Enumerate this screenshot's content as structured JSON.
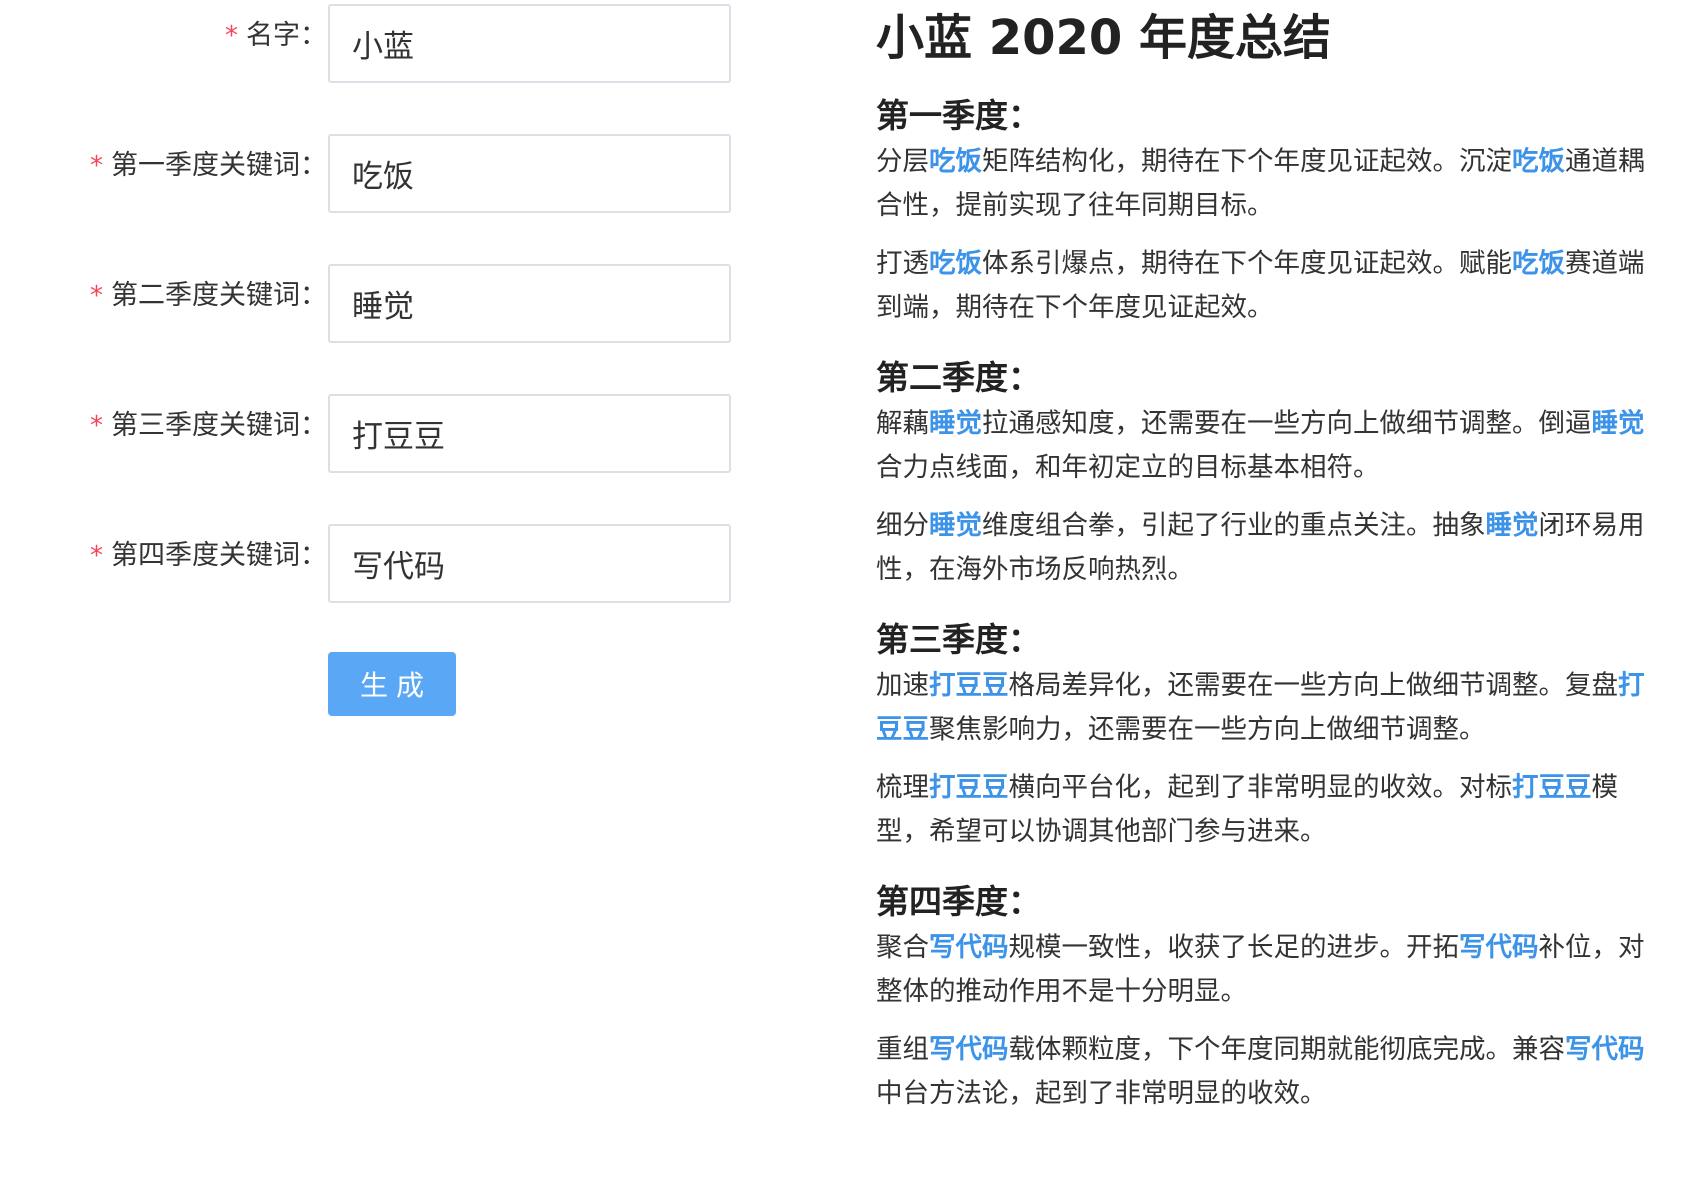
{
  "form": {
    "required_mark": "*",
    "fields": [
      {
        "label": "名字：",
        "value": "小蓝"
      },
      {
        "label": "第一季度关键词：",
        "value": "吃饭"
      },
      {
        "label": "第二季度关键词：",
        "value": "睡觉"
      },
      {
        "label": "第三季度关键词：",
        "value": "打豆豆"
      },
      {
        "label": "第四季度关键词：",
        "value": "写代码"
      }
    ],
    "submit_label": "生成"
  },
  "summary": {
    "title": "小蓝 2020 年度总结",
    "quarters": [
      {
        "heading": "第一季度：",
        "keyword": "吃饭",
        "paragraphs": [
          {
            "a": "分层",
            "b": "矩阵结构化，期待在下个年度见证起效。沉淀",
            "c": "通道耦合性，提前实现了往年同期目标。"
          },
          {
            "a": "打透",
            "b": "体系引爆点，期待在下个年度见证起效。赋能",
            "c": "赛道端到端，期待在下个年度见证起效。"
          }
        ]
      },
      {
        "heading": "第二季度：",
        "keyword": "睡觉",
        "paragraphs": [
          {
            "a": "解藕",
            "b": "拉通感知度，还需要在一些方向上做细节调整。倒逼",
            "c": "合力点线面，和年初定立的目标基本相符。"
          },
          {
            "a": "细分",
            "b": "维度组合拳，引起了行业的重点关注。抽象",
            "c": "闭环易用性，在海外市场反响热烈。"
          }
        ]
      },
      {
        "heading": "第三季度：",
        "keyword": "打豆豆",
        "paragraphs": [
          {
            "a": "加速",
            "b": "格局差异化，还需要在一些方向上做细节调整。复盘",
            "c": "聚焦影响力，还需要在一些方向上做细节调整。"
          },
          {
            "a": "梳理",
            "b": "横向平台化，起到了非常明显的收效。对标",
            "c": "模型，希望可以协调其他部门参与进来。"
          }
        ]
      },
      {
        "heading": "第四季度：",
        "keyword": "写代码",
        "paragraphs": [
          {
            "a": "聚合",
            "b": "规模一致性，收获了长足的进步。开拓",
            "c": "补位，对整体的推动作用不是十分明显。"
          },
          {
            "a": "重组",
            "b": "载体颗粒度，下个年度同期就能彻底完成。兼容",
            "c": "中台方法论，起到了非常明显的收效。"
          }
        ]
      }
    ]
  }
}
